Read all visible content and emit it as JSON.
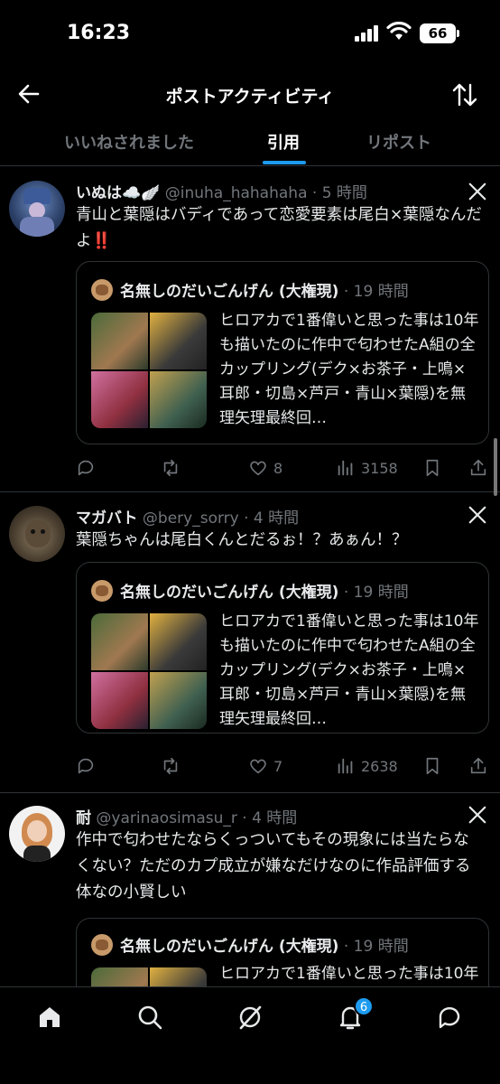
{
  "status": {
    "time": "16:23",
    "battery": "66"
  },
  "header": {
    "title": "ポストアクティビティ"
  },
  "tabs": [
    {
      "label": "いいねされました"
    },
    {
      "label": "引用"
    },
    {
      "label": "リポスト"
    }
  ],
  "quoted": {
    "name": "名無しのだいごんげん (大権現)",
    "time": "· 19 時間",
    "text": "ヒロアカで1番偉いと思った事は10年も描いたのに作中で匂わせたA組の全カップリング(デク×お茶子・上鳴×耳郎・切島×芦戸・青山×葉隠)を無理矢理最終回…"
  },
  "tweets": [
    {
      "name": "いぬは☁️🪽",
      "handle": "@inuha_hahahaha · 5 時間",
      "text": "青山と葉隠はバディであって恋愛要素は尾白×葉隠なんだよ",
      "emphasis": "‼️",
      "replies": "",
      "reposts": "",
      "likes": "8",
      "views": "3158"
    },
    {
      "name": "マガバト",
      "handle": "@bery_sorry · 4 時間",
      "text": "葉隠ちゃんは尾白くんとだるぉ！？あぁん！？",
      "emphasis": "",
      "replies": "",
      "reposts": "",
      "likes": "7",
      "views": "2638"
    },
    {
      "name": "耐",
      "handle": "@yarinaosimasu_r · 4 時間",
      "text": "作中で匂わせたならくっついてもその現象には当たらなくない？ただのカプ成立が嫌なだけなのに作品評価する体なの小賢しい",
      "emphasis": ""
    }
  ],
  "nav": {
    "notifications_badge": "6"
  },
  "colors": {
    "accent": "#1d9bf0",
    "background": "#000000",
    "muted": "#71767b"
  }
}
